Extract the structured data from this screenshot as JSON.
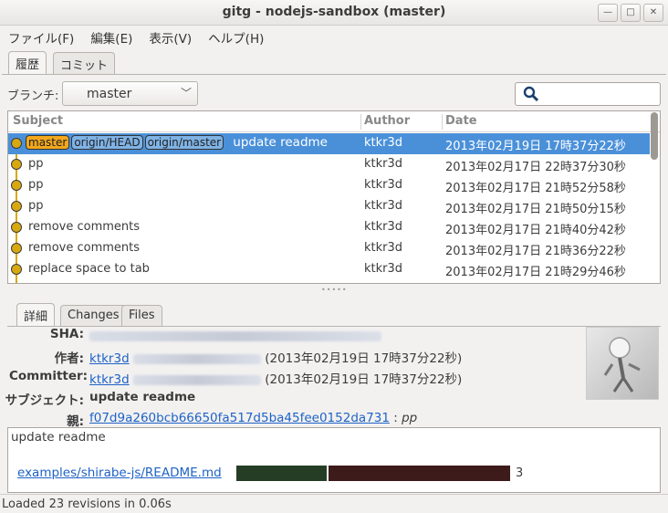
{
  "window": {
    "title": "gitg - nodejs-sandbox (master)"
  },
  "menu": [
    "ファイル(F)",
    "編集(E)",
    "表示(V)",
    "ヘルプ(H)"
  ],
  "top_tabs": [
    {
      "label": "履歴",
      "active": true
    },
    {
      "label": "コミット",
      "active": false
    }
  ],
  "branch": {
    "label": "ブランチ:",
    "value": "master"
  },
  "search": {
    "value": ""
  },
  "history": {
    "columns": {
      "subject": "Subject",
      "author": "Author",
      "date": "Date"
    },
    "rows": [
      {
        "refs": [
          {
            "name": "master",
            "kind": "local"
          },
          {
            "name": "origin/HEAD",
            "kind": "remote"
          },
          {
            "name": "origin/master",
            "kind": "remote"
          }
        ],
        "subject": "update readme",
        "author": "ktkr3d",
        "date": "2013年02月19日 17時37分22秒",
        "selected": true
      },
      {
        "refs": [],
        "subject": "pp",
        "author": "ktkr3d",
        "date": "2013年02月17日 22時37分30秒"
      },
      {
        "refs": [],
        "subject": "pp",
        "author": "ktkr3d",
        "date": "2013年02月17日 21時52分58秒"
      },
      {
        "refs": [],
        "subject": "pp",
        "author": "ktkr3d",
        "date": "2013年02月17日 21時50分15秒"
      },
      {
        "refs": [],
        "subject": "remove comments",
        "author": "ktkr3d",
        "date": "2013年02月17日 21時40分42秒"
      },
      {
        "refs": [],
        "subject": "remove comments",
        "author": "ktkr3d",
        "date": "2013年02月17日 21時36分22秒"
      },
      {
        "refs": [],
        "subject": "replace space to tab",
        "author": "ktkr3d",
        "date": "2013年02月17日 21時29分46秒"
      }
    ]
  },
  "detail_tabs": [
    {
      "label": "詳細",
      "active": true
    },
    {
      "label": "Changes",
      "active": false
    },
    {
      "label": "Files",
      "active": false
    }
  ],
  "detail": {
    "sha_label": "SHA:",
    "author_label": "作者:",
    "author_name": "ktkr3d",
    "author_date": "(2013年02月19日 17時37分22秒)",
    "committer_label": "Committer:",
    "committer_name": "ktkr3d",
    "committer_date": "(2013年02月19日 17時37分22秒)",
    "subject_label": "サブジェクト:",
    "subject_value": "update readme",
    "parent_label": "親:",
    "parent_sha": "f07d9a260bcb66650fa517d5ba45fee0152da731",
    "parent_sep": ":",
    "parent_subject": "pp"
  },
  "message": {
    "text": "update readme",
    "file": "examples/shirabe-js/README.md",
    "diff_count": "3",
    "added_fraction": 0.33,
    "removed_fraction": 0.67,
    "added_color": "#263d25",
    "removed_color": "#3e1b1b"
  },
  "status": "Loaded 23 revisions in 0.06s",
  "colors": {
    "selection": "#4a90d9",
    "lane": "#d8a810",
    "link": "#1e62c6"
  }
}
